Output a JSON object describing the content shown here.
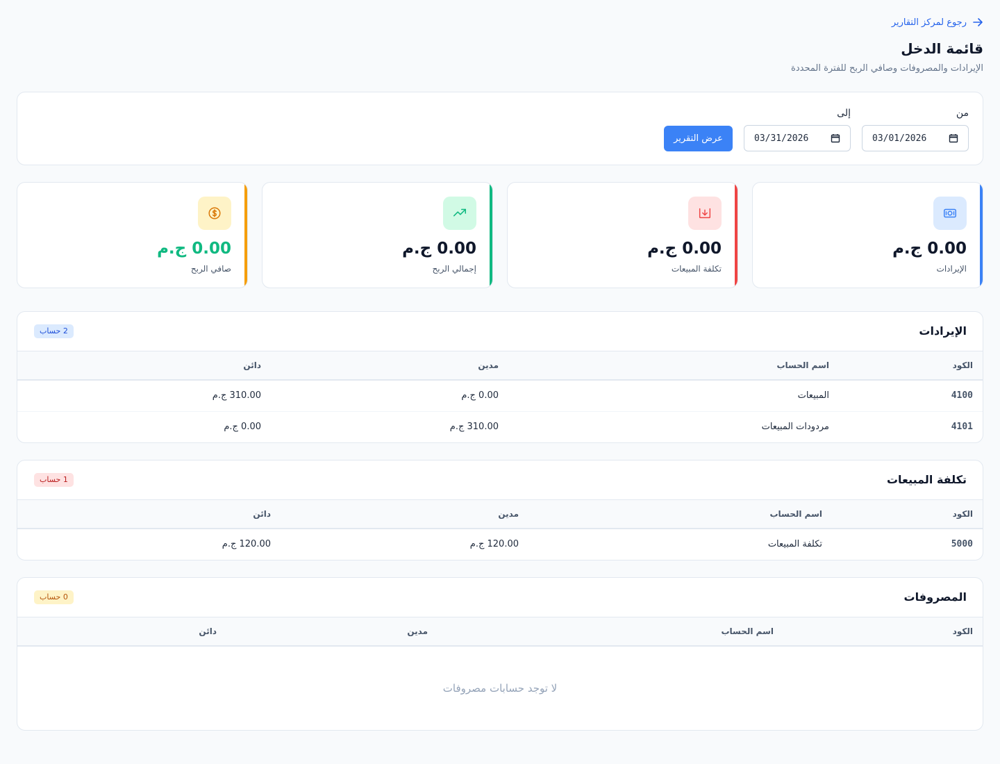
{
  "header": {
    "back_label": "رجوع لمركز التقارير",
    "title": "قائمة الدخل",
    "subtitle": "الإيرادات والمصروفات وصافي الربح للفترة المحددة"
  },
  "filter": {
    "from_label": "من",
    "from_value": "03/01/2026",
    "to_label": "إلى",
    "to_value": "03/31/2026",
    "submit_label": "عرض التقرير"
  },
  "stats": [
    {
      "label": "الإيرادات",
      "value": "0.00 ج.م",
      "icon": "cash-icon",
      "color": "#3b82f6"
    },
    {
      "label": "تكلفة المبيعات",
      "value": "0.00 ج.م",
      "icon": "tray-download-icon",
      "color": "#ef4444"
    },
    {
      "label": "إجمالي الربح",
      "value": "0.00 ج.م",
      "icon": "trend-up-icon",
      "color": "#10b981"
    },
    {
      "label": "صافي الربح",
      "value": "0.00 ج.م",
      "icon": "dollar-circle-icon",
      "color": "#f59e0b"
    }
  ],
  "columns": {
    "code": "الكود",
    "name": "اسم الحساب",
    "debit": "مدين",
    "credit": "دائن"
  },
  "sections": {
    "revenue": {
      "title": "الإيرادات",
      "badge": "2 حساب",
      "rows": [
        {
          "code": "4100",
          "name": "المبيعات",
          "debit": "0.00 ج.م",
          "credit": "310.00 ج.م"
        },
        {
          "code": "4101",
          "name": "مردودات المبيعات",
          "debit": "310.00 ج.م",
          "credit": "0.00 ج.م"
        }
      ]
    },
    "cogs": {
      "title": "تكلفة المبيعات",
      "badge": "1 حساب",
      "rows": [
        {
          "code": "5000",
          "name": "تكلفة المبيعات",
          "debit": "120.00 ج.م",
          "credit": "120.00 ج.م"
        }
      ]
    },
    "expenses": {
      "title": "المصروفات",
      "badge": "0 حساب",
      "empty_message": "لا توجد حسابات مصروفات"
    }
  }
}
